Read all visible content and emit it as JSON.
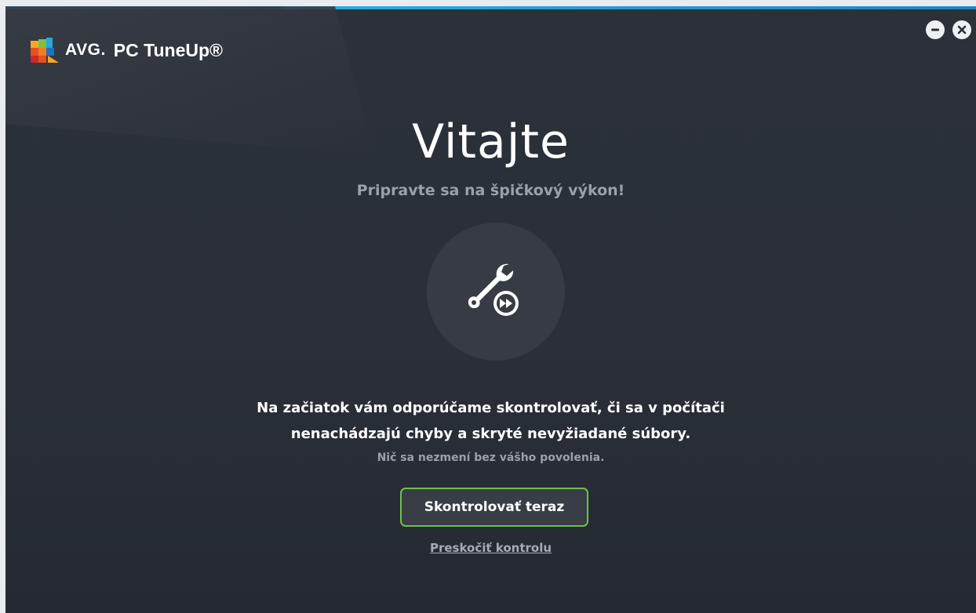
{
  "app": {
    "brand": "AVG.",
    "product": "PC TuneUp®"
  },
  "window_controls": {
    "minimize_icon": "minus-circle-icon",
    "close_icon": "close-circle-icon"
  },
  "welcome": {
    "title": "Vitajte",
    "subtitle": "Pripravte sa na špičkový výkon!",
    "icon": "wrench-fast-forward-icon",
    "description_line1": "Na začiatok vám odporúčame skontrolovať, či sa v počítači",
    "description_line2": "nenachádzajú chyby a skryté nevyžiadané súbory.",
    "note": "Nič sa nezmení bez vášho povolenia.",
    "scan_button": "Skontrolovať teraz",
    "skip_link": "Preskočiť kontrolu"
  },
  "colors": {
    "background": "#2b3039",
    "accent_green": "#6cc24a",
    "accent_blue": "#29aee6",
    "muted_text": "#9aa1ab"
  }
}
